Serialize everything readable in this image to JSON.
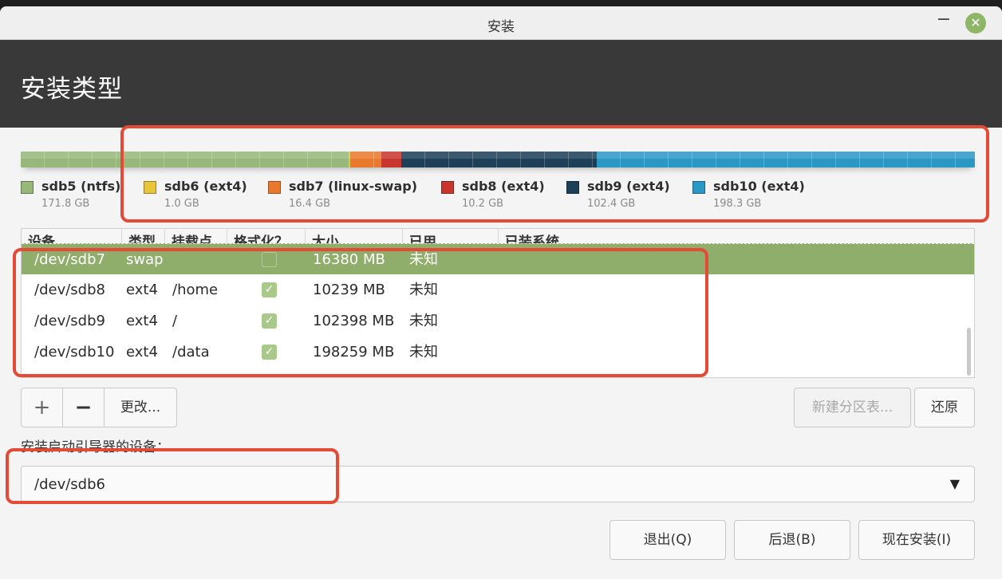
{
  "window": {
    "title": "安装",
    "minimize_glyph": "−",
    "close_glyph": "✕"
  },
  "header": {
    "title": "安装类型"
  },
  "partitions_bar": {
    "segments": [
      {
        "name": "sdb5",
        "color": "#97b77b",
        "gb": 171.8
      },
      {
        "name": "sdb6",
        "color": "#e8c53a",
        "gb": 1.0
      },
      {
        "name": "sdb7",
        "color": "#e8792d",
        "gb": 16.4
      },
      {
        "name": "sdb8",
        "color": "#c8372f",
        "gb": 10.2
      },
      {
        "name": "sdb9",
        "color": "#1d3f58",
        "gb": 102.4
      },
      {
        "name": "sdb10",
        "color": "#2a98c4",
        "gb": 198.3
      }
    ]
  },
  "legend": [
    {
      "label": "sdb5 (ntfs)",
      "size": "171.8 GB",
      "color": "#97b77b"
    },
    {
      "label": "sdb6 (ext4)",
      "size": "1.0 GB",
      "color": "#e8c53a"
    },
    {
      "label": "sdb7 (linux-swap)",
      "size": "16.4 GB",
      "color": "#e8792d"
    },
    {
      "label": "sdb8 (ext4)",
      "size": "10.2 GB",
      "color": "#c8372f"
    },
    {
      "label": "sdb9 (ext4)",
      "size": "102.4 GB",
      "color": "#1d3f58"
    },
    {
      "label": "sdb10 (ext4)",
      "size": "198.3 GB",
      "color": "#2a98c4"
    }
  ],
  "table": {
    "columns": [
      "设备",
      "类型",
      "挂载点",
      "格式化？",
      "大小",
      "已用",
      "已装系统"
    ],
    "rows": [
      {
        "device": "/dev/sdb7",
        "type": "swap",
        "mount": "",
        "format": false,
        "size": "16380 MB",
        "used": "未知",
        "system": "",
        "selected": true
      },
      {
        "device": "/dev/sdb8",
        "type": "ext4",
        "mount": "/home",
        "format": true,
        "size": "10239 MB",
        "used": "未知",
        "system": "",
        "selected": false
      },
      {
        "device": "/dev/sdb9",
        "type": "ext4",
        "mount": "/",
        "format": true,
        "size": "102398 MB",
        "used": "未知",
        "system": "",
        "selected": false
      },
      {
        "device": "/dev/sdb10",
        "type": "ext4",
        "mount": "/data",
        "format": true,
        "size": "198259 MB",
        "used": "未知",
        "system": "",
        "selected": false
      }
    ]
  },
  "actions": {
    "add": "+",
    "remove": "−",
    "change": "更改...",
    "new_table": "新建分区表...",
    "revert": "还原"
  },
  "bootloader": {
    "label": "安装启动引导器的设备：",
    "value": "/dev/sdb6",
    "arrow": "▼"
  },
  "footer": {
    "quit": "退出(Q)",
    "back": "后退(B)",
    "install_now": "现在安装(I)"
  },
  "check_glyph": "✓",
  "annotation_color": "#e54a37"
}
